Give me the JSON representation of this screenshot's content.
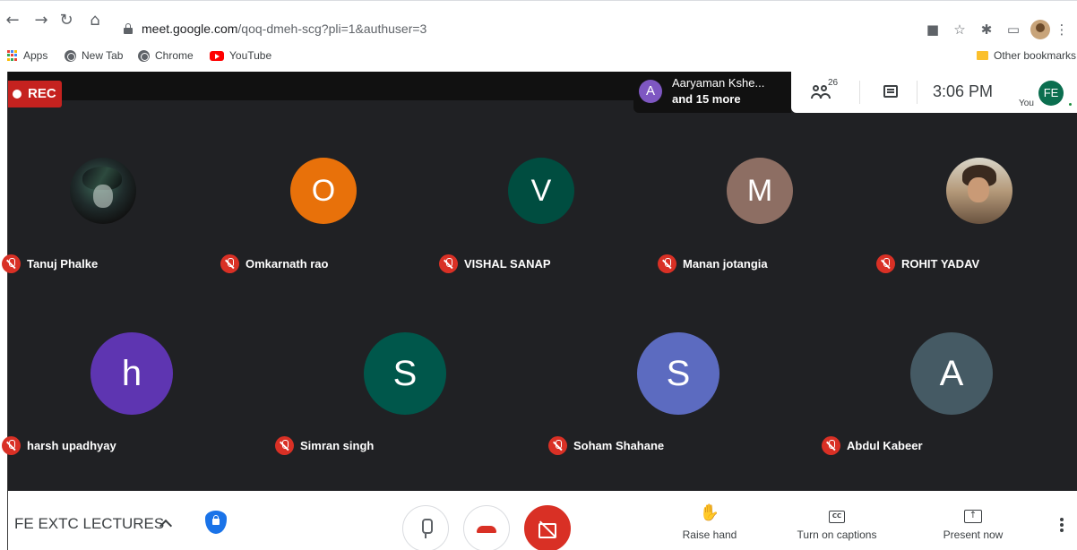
{
  "browser": {
    "url_host": "meet.google.com",
    "url_path": "/qoq-dmeh-scg?pli=1&authuser=3",
    "bookmarks": [
      "Apps",
      "New Tab",
      "Chrome",
      "YouTube"
    ],
    "other_bookmarks": "Other bookmarks"
  },
  "meet": {
    "rec_label": "REC",
    "presenter": {
      "initial": "A",
      "name": "Aaryaman Kshe...",
      "more": "and 15 more"
    },
    "people_count": "26",
    "time": "3:06 PM",
    "you": {
      "initials": "FE",
      "label": "You"
    },
    "participants_row1": [
      {
        "name": "Tanuj Phalke",
        "initial": "",
        "color": "#1f2b2b"
      },
      {
        "name": "Omkarnath rao",
        "initial": "O",
        "color": "#e8710a"
      },
      {
        "name": "VISHAL SANAP",
        "initial": "V",
        "color": "#004d40"
      },
      {
        "name": "Manan jotangia",
        "initial": "M",
        "color": "#8d6e63"
      },
      {
        "name": "ROHIT YADAV",
        "initial": "",
        "color": "#b59a7a"
      }
    ],
    "participants_row2": [
      {
        "name": "harsh upadhyay",
        "initial": "h",
        "color": "#5e35b1"
      },
      {
        "name": "Simran singh",
        "initial": "S",
        "color": "#00574b"
      },
      {
        "name": "Soham Shahane",
        "initial": "S",
        "color": "#5c6bc0"
      },
      {
        "name": "Abdul Kabeer",
        "initial": "A",
        "color": "#455a64"
      }
    ],
    "meeting_title": "FE EXTC LECTURES",
    "actions": {
      "raise_hand": "Raise hand",
      "captions": "Turn on captions",
      "present": "Present now"
    }
  }
}
